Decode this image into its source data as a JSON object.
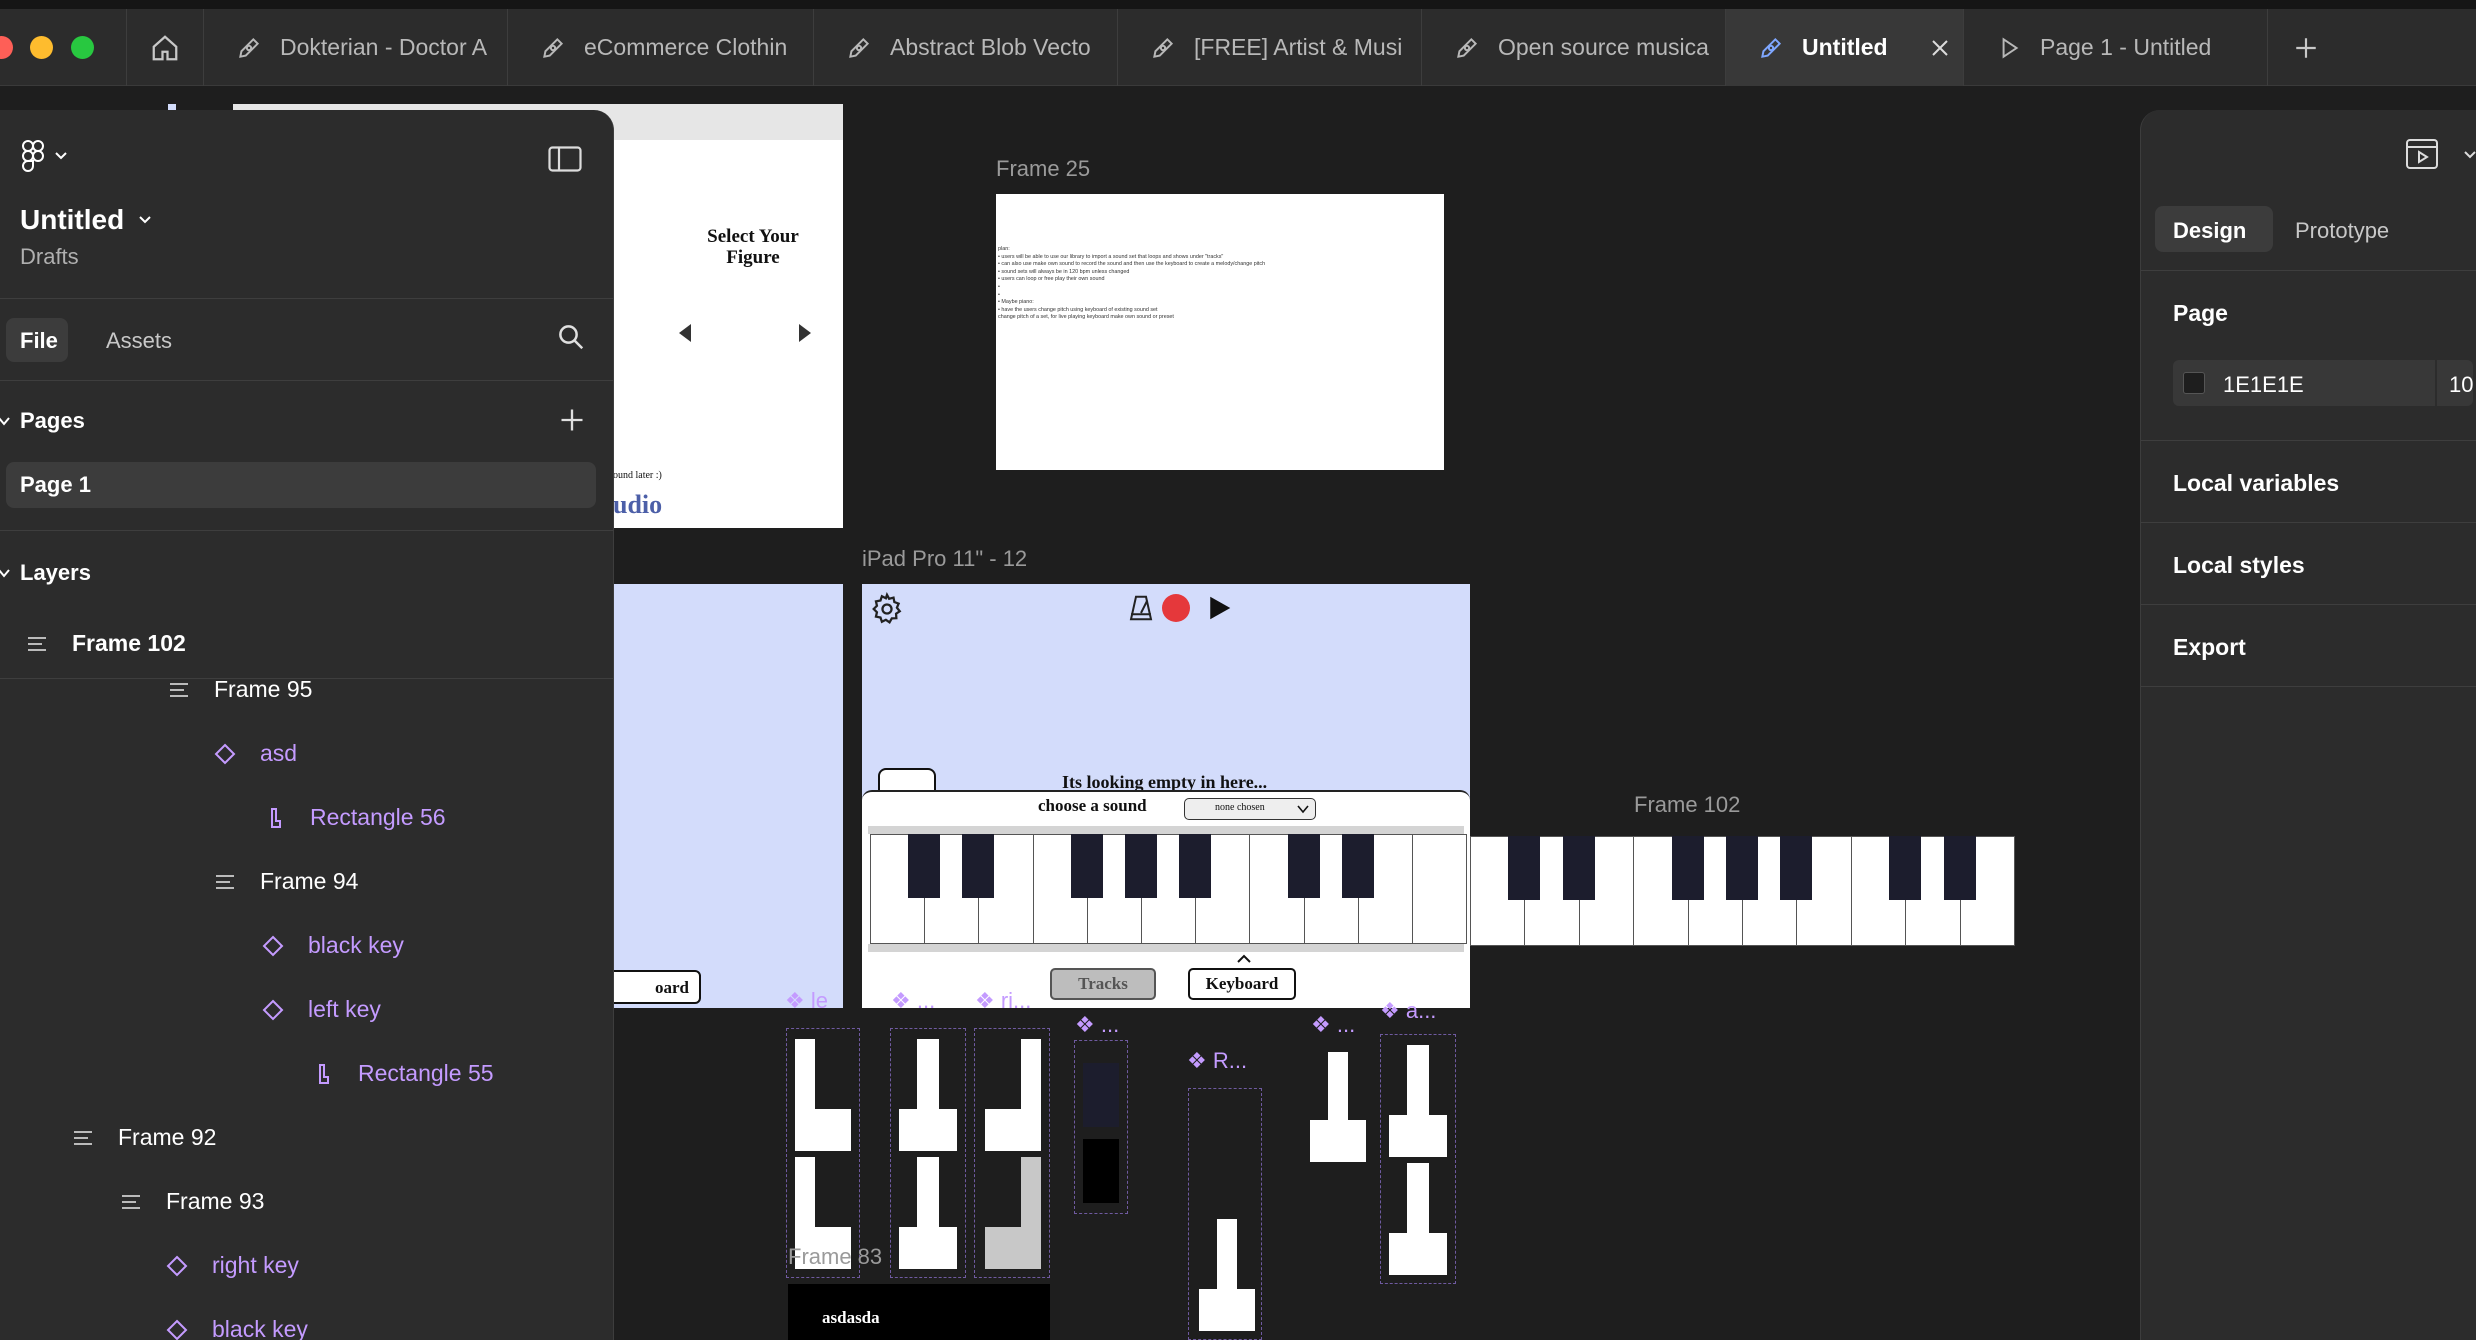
{
  "tabs": [
    {
      "label": "Dokterian - Doctor A"
    },
    {
      "label": "eCommerce Clothin"
    },
    {
      "label": "Abstract Blob Vecto"
    },
    {
      "label": "[FREE] Artist & Musi"
    },
    {
      "label": "Open source musica"
    },
    {
      "label": "Untitled"
    },
    {
      "label": "Page 1 - Untitled"
    }
  ],
  "left_panel": {
    "file_name": "Untitled",
    "location": "Drafts",
    "tab_file": "File",
    "tab_assets": "Assets",
    "pages_header": "Pages",
    "current_page": "Page 1",
    "layers_header": "Layers",
    "layers": [
      {
        "name": "Frame 102",
        "kind": "frame"
      },
      {
        "name": "Frame 95",
        "kind": "frame"
      },
      {
        "name": "asd",
        "kind": "component"
      },
      {
        "name": "Rectangle 56",
        "kind": "rect"
      },
      {
        "name": "Frame 94",
        "kind": "frame"
      },
      {
        "name": "black key",
        "kind": "component"
      },
      {
        "name": "left key",
        "kind": "component"
      },
      {
        "name": "Rectangle 55",
        "kind": "rect"
      },
      {
        "name": "Frame 92",
        "kind": "frame"
      },
      {
        "name": "Frame 93",
        "kind": "frame"
      },
      {
        "name": "right key",
        "kind": "component"
      },
      {
        "name": "black key",
        "kind": "component"
      }
    ]
  },
  "right_panel": {
    "tab_design": "Design",
    "tab_prototype": "Prototype",
    "page_label": "Page",
    "bg_hex": "1E1E1E",
    "bg_opacity": "10",
    "local_variables": "Local variables",
    "local_styles": "Local styles",
    "export": "Export"
  },
  "canvas": {
    "frame25_label": "Frame 25",
    "frame25_notes": [
      "plan:",
      "• users will be able to use our library to import a sound set that loops and shows under \"tracks\"",
      "• can also use make own sound to record the sound and then use the keyboard to create a melody/change pitch",
      "• sound sets will always be in 120 bpm unless changed",
      "• users can loop or free play their own sound",
      "•",
      "•",
      "• Maybe piano:",
      "• have the users change pitch using keyboard of existing sound set",
      "change pitch of a set, for live playing keyboard make own sound or preset"
    ],
    "select_title_1": "Select Your",
    "select_title_2": "Figure",
    "select_small": "ound later :)",
    "select_brand": "udio",
    "keyboard_partial": "oard",
    "ipad_label": "iPad Pro 11\" - 12",
    "empty_text": "Its looking empty in here...",
    "choose_sound": "choose a sound",
    "none_chosen": "none chosen",
    "tracks_btn": "Tracks",
    "keyboard_btn": "Keyboard",
    "frame102_label": "Frame 102",
    "frame83_label": "Frame 83",
    "asdasda": "asdasda",
    "comp_labels": [
      "le",
      "...",
      "ri...",
      "...",
      "R...",
      "...",
      "a..."
    ]
  },
  "colors": {
    "canvas_bg": "#1E1E1E",
    "panel_bg": "#2C2C2C",
    "accent_component": "#C49BFF",
    "ipad_bg": "#D3DCFB",
    "record_red": "#E5383B",
    "black_key": "#1C1D2D"
  }
}
